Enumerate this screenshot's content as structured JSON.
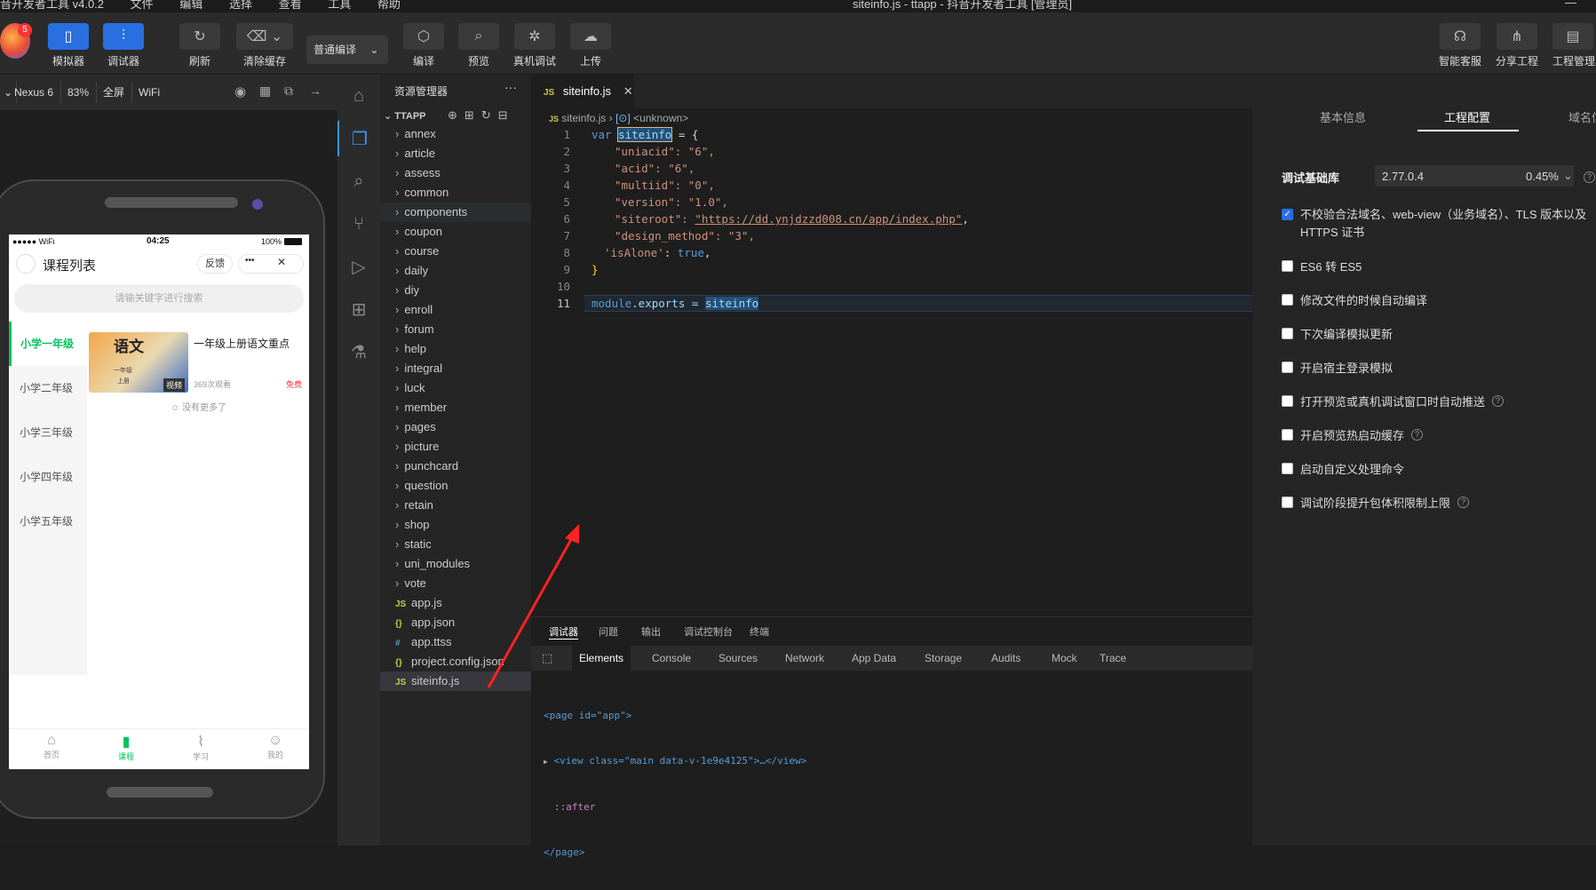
{
  "titlebar": {
    "app": "音开发者工具 v4.0.2",
    "menu": [
      "文件",
      "编辑",
      "选择",
      "查看",
      "工具",
      "帮助"
    ],
    "window_title": "siteinfo.js - ttapp - 抖音开发者工具 [管理员]",
    "close": "—"
  },
  "toolbar": {
    "avatar_badge": "5",
    "simulator": "模拟器",
    "debugger": "调试器",
    "refresh": "刷新",
    "clear_cache": "清除缓存",
    "compile_mode": "普通编译",
    "compile": "编译",
    "preview": "预览",
    "real_debug": "真机调试",
    "upload": "上传",
    "support": "智能客服",
    "share": "分享工程",
    "project": "工程管理"
  },
  "devbar": {
    "device": "Nexus 6",
    "zoom": "83%",
    "fullscreen": "全屏",
    "network": "WiFi"
  },
  "phone": {
    "status_left": "●●●●● WiFi",
    "time": "04:25",
    "battery": "100%",
    "page_title": "课程列表",
    "feedback": "反馈",
    "more": "•••",
    "close": "✕",
    "search_placeholder": "请输关键字进行搜索",
    "grades": [
      "小学一年级",
      "小学二年级",
      "小学三年级",
      "小学四年级",
      "小学五年级"
    ],
    "course_title": "一年级上册语文重点",
    "course_views": "369次观看",
    "course_price": "免费",
    "course_tag": "视频",
    "book_title": "语文",
    "book_grade": "一年级",
    "book_term": "上册",
    "no_more": "没有更多了",
    "tabs": [
      "首页",
      "课程",
      "学习",
      "我的"
    ]
  },
  "explorer": {
    "title": "资源管理器",
    "root": "TTAPP",
    "folders": [
      "annex",
      "article",
      "assess",
      "common",
      "components",
      "coupon",
      "course",
      "daily",
      "diy",
      "enroll",
      "forum",
      "help",
      "integral",
      "luck",
      "member",
      "pages",
      "picture",
      "punchcard",
      "question",
      "retain",
      "shop",
      "static",
      "uni_modules",
      "vote"
    ],
    "files": [
      {
        "icon": "JS",
        "name": "app.js",
        "color": "#cbcb41"
      },
      {
        "icon": "{}",
        "name": "app.json",
        "color": "#cbcb41"
      },
      {
        "icon": "#",
        "name": "app.ttss",
        "color": "#519aba"
      },
      {
        "icon": "{}",
        "name": "project.config.json",
        "color": "#cbcb41"
      },
      {
        "icon": "JS",
        "name": "siteinfo.js",
        "color": "#cbcb41"
      }
    ]
  },
  "editor": {
    "tab": "siteinfo.js",
    "tab_icon": "JS",
    "breadcrumb_file": "siteinfo.js",
    "breadcrumb_symbol": "<unknown>",
    "lines": [
      "1",
      "2",
      "3",
      "4",
      "5",
      "6",
      "7",
      "8",
      "9",
      "10",
      "11"
    ],
    "code": {
      "l1_kw": "var",
      "l1_var": "siteinfo",
      "l1_rest": " = {",
      "l2": "\"uniacid\": \"6\",",
      "l3": "\"acid\": \"6\",",
      "l4": "\"multiid\": \"0\",",
      "l5": "\"version\": \"1.0\",",
      "l6_key": "\"siteroot\": ",
      "l6_val": "\"https://dd.ynjdzzd008.cn/app/index.php\"",
      "l6_end": ",",
      "l7": "\"design_method\": \"3\",",
      "l8_key": "'isAlone'",
      "l8_sep": ": ",
      "l8_val": "true",
      "l8_end": ",",
      "l9": "}",
      "l11_a": "module",
      "l11_b": ".exports = ",
      "l11_c": "siteinfo"
    }
  },
  "bottom": {
    "panel_tabs": [
      "调试器",
      "问题",
      "输出",
      "调试控制台",
      "终端"
    ],
    "dev_tabs": [
      "Elements",
      "Console",
      "Sources",
      "Network",
      "App Data",
      "Storage",
      "Audits",
      "Mock",
      "Trace"
    ],
    "dom": {
      "l1": "<page id=\"app\">",
      "l2": "<view class=\"main data-v-1e9e4125\">…</view>",
      "l3": "::after",
      "l4": "</page>"
    }
  },
  "settings": {
    "tabs": [
      "基本信息",
      "工程配置",
      "域名信息"
    ],
    "lib_label": "调试基础库",
    "lib_version": "2.77.0.4",
    "lib_percent": "0.45%",
    "options": [
      {
        "label": "不校验合法域名、web-view（业务域名）、TLS 版本以及 HTTPS 证书",
        "checked": true,
        "help": false
      },
      {
        "label": "ES6 转 ES5",
        "checked": false,
        "help": false
      },
      {
        "label": "修改文件的时候自动编译",
        "checked": false,
        "help": false
      },
      {
        "label": "下次编译模拟更新",
        "checked": false,
        "help": false
      },
      {
        "label": "开启宿主登录模拟",
        "checked": false,
        "help": false
      },
      {
        "label": "打开预览或真机调试窗口时自动推送",
        "checked": false,
        "help": true
      },
      {
        "label": "开启预览热启动缓存",
        "checked": false,
        "help": true
      },
      {
        "label": "启动自定义处理命令",
        "checked": false,
        "help": false
      },
      {
        "label": "调试阶段提升包体积限制上限",
        "checked": false,
        "help": true
      }
    ]
  },
  "colors": {
    "accent_green": "#07c160",
    "accent_blue": "#2a6fe0",
    "annotation_arrow": "#ff2222"
  }
}
